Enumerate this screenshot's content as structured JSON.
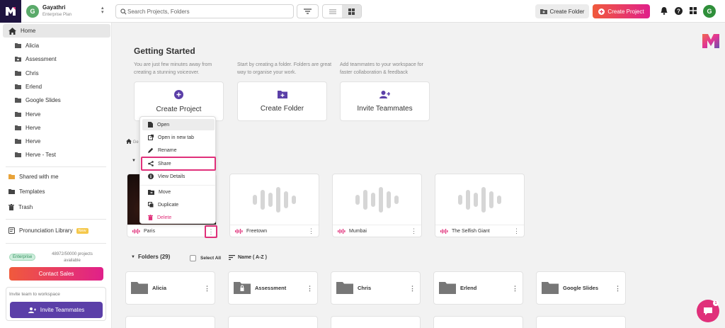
{
  "colors": {
    "accent": "#e0307a",
    "brand_purple": "#5b3fa8",
    "gradient_start": "#f05a3c",
    "gradient_end": "#e0208a",
    "enterprise_green": "#2d8f5a"
  },
  "workspace": {
    "name": "Gayathri",
    "plan": "Enterprise Plan",
    "avatar_letter": "G"
  },
  "header": {
    "search_placeholder": "Search Projects, Folders",
    "create_folder_label": "Create Folder",
    "create_project_label": "Create Project",
    "user_avatar_letter": "G",
    "icons": [
      "filter-icon",
      "list-view-icon",
      "grid-view-icon",
      "bell-icon",
      "help-icon",
      "apps-grid-icon"
    ]
  },
  "sidebar": {
    "home_label": "Home",
    "folders": [
      "Alicia",
      "Assessment",
      "Chris",
      "Erlend",
      "Google Slides",
      "Herve",
      "Herve",
      "Herve",
      "Herve - Test"
    ],
    "shared_label": "Shared with me",
    "templates_label": "Templates",
    "trash_label": "Trash",
    "pronunciation_label": "Pronunciation Library",
    "new_badge": "New",
    "enterprise_badge": "Enterprise",
    "quota_line1": "48972/50000 projects",
    "quota_line2": "available",
    "contact_sales_label": "Contact Sales",
    "invite_placeholder": "Invite team to workspace",
    "invite_button_label": "Invite Teammates"
  },
  "getting_started": {
    "title": "Getting Started",
    "cards": [
      {
        "desc": "You are just few minutes away from creating a stunning voiceover.",
        "label": "Create Project",
        "icon": "plus-circle-icon"
      },
      {
        "desc": "Start by creating a folder. Folders are great way to organise your work.",
        "label": "Create Folder",
        "icon": "folder-plus-icon"
      },
      {
        "desc": "Add teammates to your workspace for faster collaboration & feedback",
        "label": "Invite Teammates",
        "icon": "add-user-icon"
      }
    ]
  },
  "breadcrumb": {
    "text": "Ge"
  },
  "projects": [
    {
      "name": "Paris",
      "thumbnail": "photo"
    },
    {
      "name": "Freetown",
      "thumbnail": "waveform"
    },
    {
      "name": "Mumbai",
      "thumbnail": "waveform"
    },
    {
      "name": "The Selfish Giant",
      "thumbnail": "waveform"
    }
  ],
  "context_menu": {
    "items": [
      {
        "label": "Open",
        "icon": "file-icon"
      },
      {
        "label": "Open in new tab",
        "icon": "external-link-icon"
      },
      {
        "label": "Rename",
        "icon": "pen-icon"
      },
      {
        "label": "Share",
        "icon": "share-icon"
      },
      {
        "label": "View Details",
        "icon": "info-icon"
      },
      {
        "label": "Move",
        "icon": "folder-move-icon"
      },
      {
        "label": "Duplicate",
        "icon": "copy-icon"
      },
      {
        "label": "Delete",
        "icon": "trash-icon"
      }
    ]
  },
  "folders_section": {
    "title": "Folders (29)",
    "select_all_label": "Select All",
    "sort_label": "Name ( A-Z )",
    "folders": [
      "Alicia",
      "Assessment",
      "Chris",
      "Erlend",
      "Google Slides"
    ]
  },
  "chat": {
    "badge": "1"
  }
}
